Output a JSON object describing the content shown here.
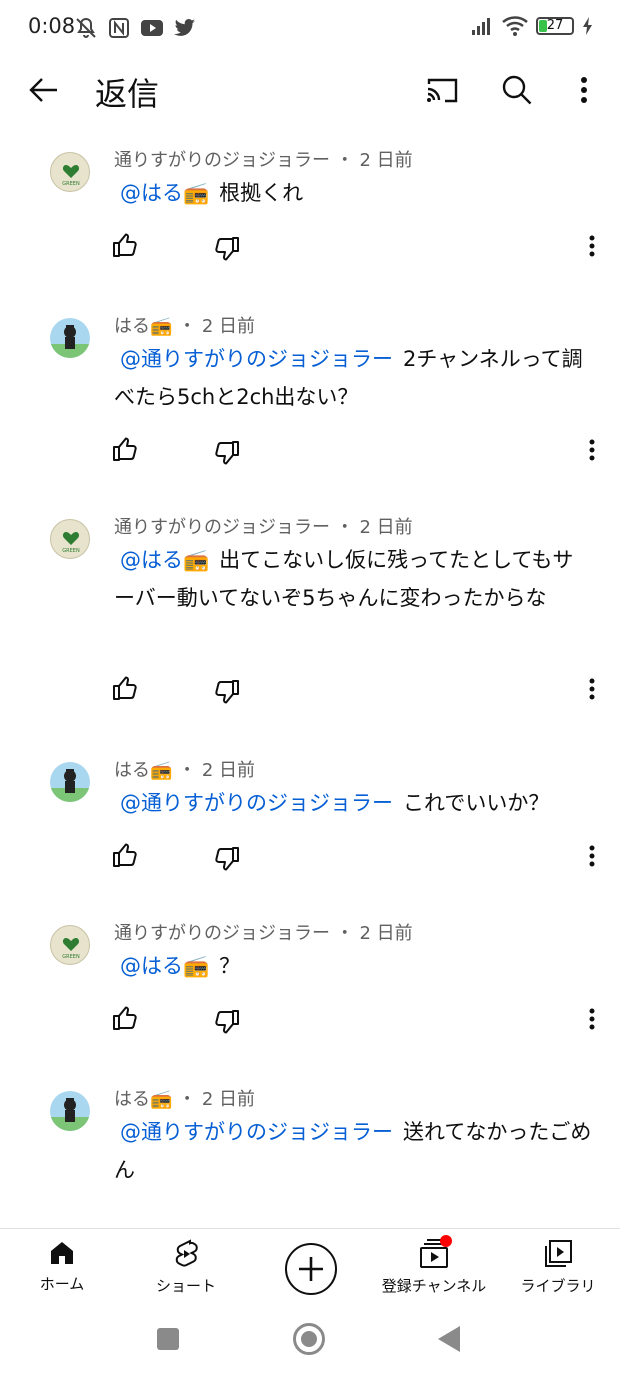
{
  "status_bar": {
    "time": "0:08",
    "battery_level": "27"
  },
  "app_bar": {
    "title": "返信"
  },
  "comments": [
    {
      "author": "通りすがりのジョジョラー",
      "time": "2 日前",
      "mention": "@はる📻",
      "text": "根拠くれ",
      "avatar": "green"
    },
    {
      "author": "はる📻",
      "time": "2 日前",
      "mention": "@通りすがりのジョジョラー",
      "text": "2チャンネルって調べたら5chと2ch出ない？",
      "avatar": "haru"
    },
    {
      "author": "通りすがりのジョジョラー",
      "time": "2 日前",
      "mention": "@はる📻",
      "text": "出てこないし仮に残ってたとしてもサーバー動いてないぞ5ちゃんに変わったからな",
      "avatar": "green"
    },
    {
      "author": "はる📻",
      "time": "2 日前",
      "mention": "@通りすがりのジョジョラー",
      "text": "これでいいか？",
      "avatar": "haru"
    },
    {
      "author": "通りすがりのジョジョラー",
      "time": "2 日前",
      "mention": "@はる📻",
      "text": "？",
      "avatar": "green"
    },
    {
      "author": "はる📻",
      "time": "2 日前",
      "mention": "@通りすがりのジョジョラー",
      "text": "送れてなかったごめん",
      "avatar": "haru"
    }
  ],
  "bottom_nav": {
    "home": "ホーム",
    "shorts": "ショート",
    "subscriptions": "登録チャンネル",
    "library": "ライブラリ"
  },
  "avatar_logo_text": "GREEN",
  "colors": {
    "mention": "#065fd4",
    "meta": "#606060",
    "notification": "#ff0000"
  },
  "icons": {
    "back": "arrow-left-icon",
    "cast": "cast-icon",
    "search": "search-icon",
    "more": "more-vert-icon",
    "like": "thumb-up-icon",
    "dislike": "thumb-down-icon"
  }
}
